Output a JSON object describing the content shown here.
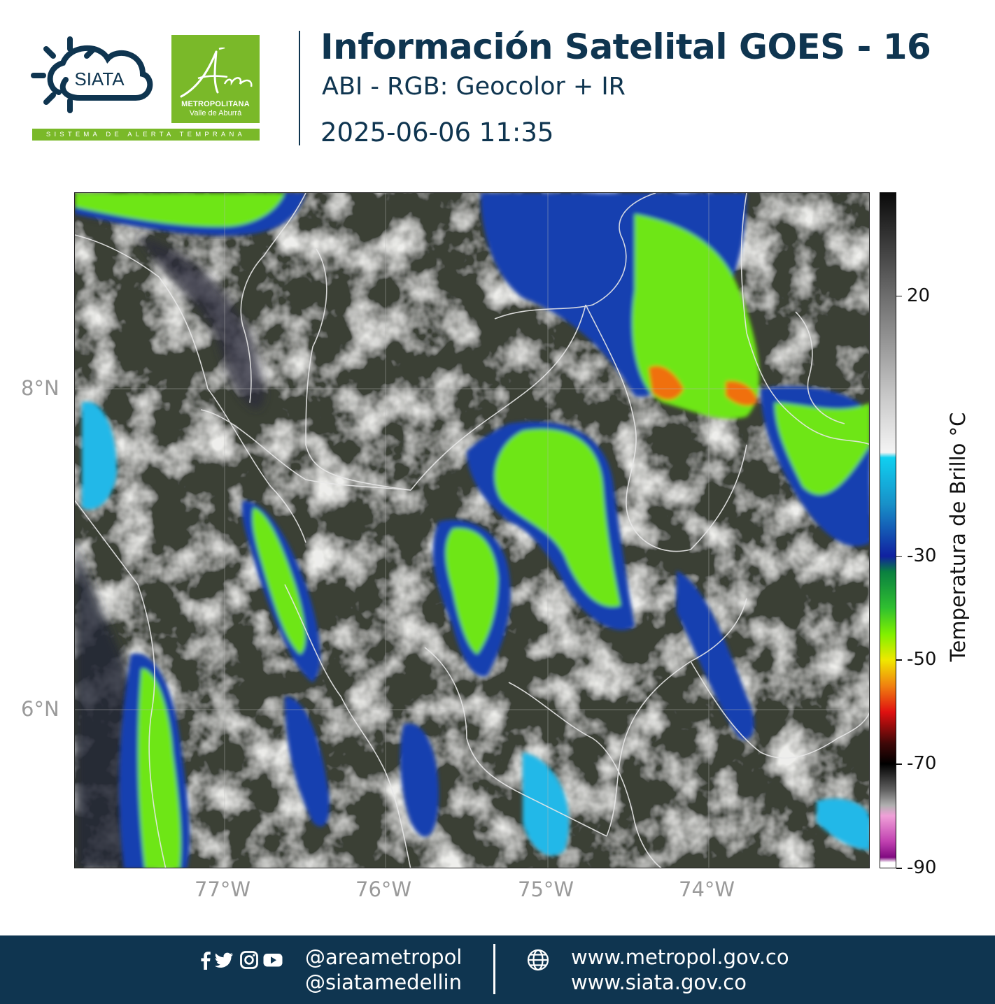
{
  "header": {
    "title": "Información Satelital GOES - 16",
    "subtitle": "ABI - RGB: Geocolor + IR",
    "datetime": "2025-06-06 11:35",
    "siata_logo_text": "SIATA",
    "siata_strip_text": "SISTEMA DE ALERTA TEMPRANA",
    "area_logo_script": "Área",
    "area_logo_line1": "METROPOLITANA",
    "area_logo_line2": "Valle de Aburrá"
  },
  "map": {
    "latitude_labels": [
      {
        "value": 8,
        "text": "8°N"
      },
      {
        "value": 6,
        "text": "6°N"
      }
    ],
    "longitude_labels": [
      {
        "value": -77,
        "text": "77°W"
      },
      {
        "value": -76,
        "text": "76°W"
      },
      {
        "value": -75,
        "text": "75°W"
      },
      {
        "value": -74,
        "text": "74°W"
      }
    ],
    "colors": {
      "cloud_top_green": "#6ee619",
      "cloud_yellow": "#e6e600",
      "cloud_orange": "#f07010",
      "cloud_blue": "#1840b0",
      "cloud_cyan": "#20b8e8",
      "boundary_line": "#e8e8e8"
    }
  },
  "colorbar": {
    "title": "Temperatura de Brillo °C",
    "range": [
      -90,
      40
    ],
    "ticks": [
      {
        "value": 20,
        "text": "20"
      },
      {
        "value": -30,
        "text": "-30"
      },
      {
        "value": -50,
        "text": "-50"
      },
      {
        "value": -70,
        "text": "-70"
      },
      {
        "value": -90,
        "text": "-90"
      }
    ],
    "stops": [
      {
        "value": 40,
        "color": "#0a0a0a"
      },
      {
        "value": 30,
        "color": "#3c3c3c"
      },
      {
        "value": 20,
        "color": "#6e6e6e"
      },
      {
        "value": 10,
        "color": "#9c9c9c"
      },
      {
        "value": 0,
        "color": "#cccccc"
      },
      {
        "value": -10,
        "color": "#f4f4f4"
      },
      {
        "value": -11,
        "color": "#10d0f0"
      },
      {
        "value": -20,
        "color": "#1890c8"
      },
      {
        "value": -30,
        "color": "#1020a0"
      },
      {
        "value": -33,
        "color": "#0a8040"
      },
      {
        "value": -40,
        "color": "#30c030"
      },
      {
        "value": -45,
        "color": "#80f000"
      },
      {
        "value": -50,
        "color": "#f0e800"
      },
      {
        "value": -55,
        "color": "#f08010"
      },
      {
        "value": -60,
        "color": "#e01010"
      },
      {
        "value": -66,
        "color": "#400808"
      },
      {
        "value": -70,
        "color": "#000000"
      },
      {
        "value": -75,
        "color": "#606060"
      },
      {
        "value": -78,
        "color": "#b0b0b0"
      },
      {
        "value": -80,
        "color": "#f0a0d8"
      },
      {
        "value": -85,
        "color": "#c040b0"
      },
      {
        "value": -88,
        "color": "#800a80"
      },
      {
        "value": -89,
        "color": "#ffffff"
      },
      {
        "value": -90,
        "color": "#ffffff"
      }
    ]
  },
  "footer": {
    "social_icons": [
      "facebook-icon",
      "twitter-icon",
      "instagram-icon",
      "youtube-icon"
    ],
    "handle_1": "@areametropol",
    "handle_2": "@siatamedellin",
    "url_1": "www.metropol.gov.co",
    "url_2": "www.siata.gov.co",
    "colors": {
      "background": "#0f3550",
      "text": "#ffffff"
    }
  }
}
